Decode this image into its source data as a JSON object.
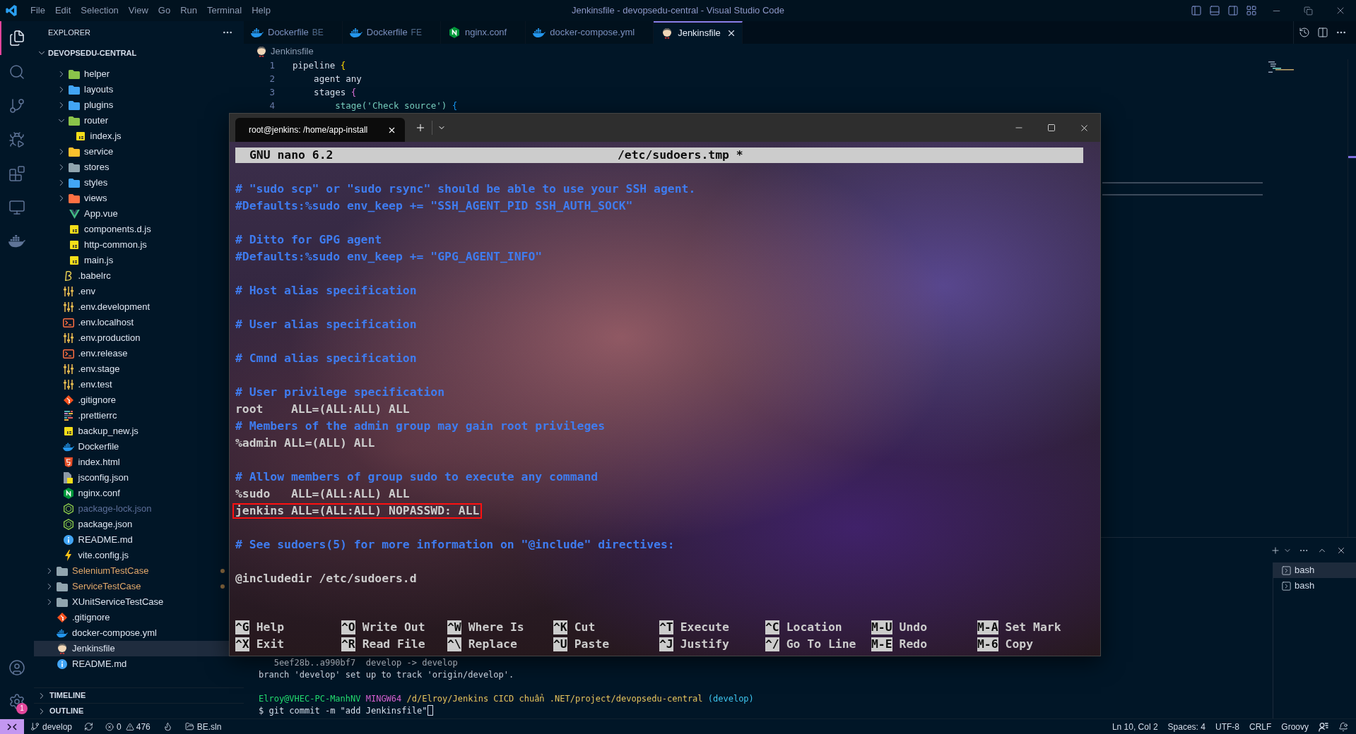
{
  "title_bar": {
    "menu": [
      "File",
      "Edit",
      "Selection",
      "View",
      "Go",
      "Run",
      "Terminal",
      "Help"
    ],
    "title": "Jenkinsfile - devopsedu-central - Visual Studio Code"
  },
  "activity_bar": {
    "items": [
      {
        "kind": "explorer",
        "selected": true
      },
      {
        "kind": "search",
        "selected": false
      },
      {
        "kind": "source-control",
        "selected": false
      },
      {
        "kind": "run-debug",
        "selected": false
      },
      {
        "kind": "extensions",
        "selected": false
      },
      {
        "kind": "remote",
        "selected": false
      },
      {
        "kind": "docker",
        "selected": false
      }
    ],
    "bottom": [
      {
        "kind": "account"
      },
      {
        "kind": "manage",
        "badge": "1"
      }
    ]
  },
  "sidebar": {
    "title": "EXPLORER",
    "folder": "DEVOPSEDU-CENTRAL",
    "tree": [
      {
        "children": [
          {
            "children": [
              {
                "label": "helper",
                "kind": "folder",
                "color": "#8bc34a",
                "expanded": false,
                "selected": false
              },
              {
                "label": "layouts",
                "kind": "folder",
                "color": "#42a5f5",
                "expanded": false,
                "selected": false
              },
              {
                "label": "plugins",
                "kind": "folder",
                "color": "#42a5f5",
                "expanded": false,
                "selected": false
              },
              {
                "label": "router",
                "kind": "folder",
                "color": "#8bc34a",
                "expanded": true,
                "selected": false,
                "children": [
                  {
                    "label": "index.js",
                    "kind": "js",
                    "selected": false
                  }
                ]
              },
              {
                "label": "service",
                "kind": "folder",
                "color": "#fbc02d",
                "expanded": false,
                "selected": false
              },
              {
                "label": "stores",
                "kind": "folder",
                "color": "#90a4ae",
                "expanded": false,
                "selected": false
              },
              {
                "label": "styles",
                "kind": "folder",
                "color": "#42a5f5",
                "expanded": false,
                "selected": false
              },
              {
                "label": "views",
                "kind": "folder",
                "color": "#ff7043",
                "expanded": false,
                "selected": false
              },
              {
                "label": "App.vue",
                "kind": "vue",
                "selected": false
              },
              {
                "label": "components.d.js",
                "kind": "js",
                "selected": false
              },
              {
                "label": "http-common.js",
                "kind": "js",
                "selected": false
              },
              {
                "label": "main.js",
                "kind": "js",
                "selected": false
              }
            ]
          },
          {
            "label": ".babelrc",
            "kind": "babel",
            "ignored": false,
            "selected": false
          },
          {
            "label": ".env",
            "kind": "env",
            "ignored": false,
            "selected": false
          },
          {
            "label": ".env.development",
            "kind": "env",
            "ignored": false,
            "selected": false
          },
          {
            "label": ".env.localhost",
            "kind": "shell",
            "ignored": false,
            "selected": false
          },
          {
            "label": ".env.production",
            "kind": "env",
            "ignored": false,
            "selected": false
          },
          {
            "label": ".env.release",
            "kind": "shell",
            "ignored": false,
            "selected": false
          },
          {
            "label": ".env.stage",
            "kind": "env",
            "ignored": false,
            "selected": false
          },
          {
            "label": ".env.test",
            "kind": "env",
            "ignored": false,
            "selected": false
          },
          {
            "label": ".gitignore",
            "kind": "git",
            "ignored": false,
            "selected": false
          },
          {
            "label": ".prettierrc",
            "kind": "prettier",
            "ignored": false,
            "selected": false
          },
          {
            "label": "backup_new.js",
            "kind": "js",
            "ignored": false,
            "selected": false
          },
          {
            "label": "Dockerfile",
            "kind": "docker",
            "ignored": false,
            "selected": false
          },
          {
            "label": "index.html",
            "kind": "html",
            "ignored": false,
            "selected": false
          },
          {
            "label": "jsconfig.json",
            "kind": "jsconfig",
            "ignored": false,
            "selected": false
          },
          {
            "label": "nginx.conf",
            "kind": "nginx",
            "ignored": false,
            "selected": false
          },
          {
            "label": "package-lock.json",
            "kind": "node",
            "ignored": true,
            "selected": false
          },
          {
            "label": "package.json",
            "kind": "node",
            "ignored": false,
            "selected": false
          },
          {
            "label": "README.md",
            "kind": "info",
            "ignored": false,
            "selected": false
          },
          {
            "label": "vite.config.js",
            "kind": "vite",
            "ignored": false,
            "selected": false
          }
        ]
      },
      {
        "label": "SeleniumTestCase",
        "kind": "folder",
        "color": "#90a4ae",
        "expanded": false,
        "modified": true,
        "selected": false
      },
      {
        "label": "ServiceTestCase",
        "kind": "folder",
        "color": "#90a4ae",
        "expanded": false,
        "modified": true,
        "selected": false
      },
      {
        "label": "XUnitServiceTestCase",
        "kind": "folder",
        "color": "#90a4ae",
        "expanded": false,
        "modified": false,
        "selected": false
      },
      {
        "label": ".gitignore",
        "kind": "git",
        "modified": false,
        "selected": false
      },
      {
        "label": "docker-compose.yml",
        "kind": "docker",
        "modified": false,
        "selected": false
      },
      {
        "label": "Jenkinsfile",
        "kind": "jenkins",
        "modified": false,
        "selected": true
      },
      {
        "label": "README.md",
        "kind": "info",
        "modified": false,
        "selected": false
      }
    ],
    "sections": [
      {
        "label": "TIMELINE",
        "expanded": false
      },
      {
        "label": "OUTLINE",
        "expanded": false
      }
    ]
  },
  "tabs": [
    {
      "label": "Dockerfile",
      "description": "BE",
      "kind": "docker",
      "selected": false
    },
    {
      "label": "Dockerfile",
      "description": "FE",
      "kind": "docker",
      "selected": false
    },
    {
      "label": "nginx.conf",
      "kind": "nginx",
      "selected": false
    },
    {
      "label": "docker-compose.yml",
      "kind": "docker",
      "selected": false
    },
    {
      "label": "Jenkinsfile",
      "kind": "jenkins",
      "selected": true
    }
  ],
  "breadcrumb": {
    "label": "Jenkinsfile",
    "kind": "jenkins"
  },
  "editor": {
    "lines": [
      {
        "number": "1",
        "tokens": [
          {
            "text": "pipeline ",
            "kind": "plain"
          },
          {
            "text": "{",
            "kind": "bracket1"
          }
        ]
      },
      {
        "number": "2",
        "tokens": [
          {
            "text": "    agent any",
            "kind": "plain"
          }
        ]
      },
      {
        "number": "3",
        "tokens": [
          {
            "text": "    stages ",
            "kind": "plain"
          },
          {
            "text": "{",
            "kind": "bracket2"
          }
        ]
      },
      {
        "number": "4",
        "tokens": [
          {
            "text": "        stage('Check source') ",
            "kind": "call"
          },
          {
            "text": "{",
            "kind": "bracket3"
          }
        ]
      }
    ]
  },
  "terminal_window": {
    "tab": "root@jenkins: /home/app-install",
    "nano": {
      "version": "GNU nano 6.2",
      "file": "/etc/sudoers.tmp *",
      "lines": [
        {
          "kind": "comment",
          "text": "# \"sudo scp\" or \"sudo rsync\" should be able to use your SSH agent.",
          "highlighted": false
        },
        {
          "kind": "comment",
          "text": "#Defaults:%sudo env_keep += \"SSH_AGENT_PID SSH_AUTH_SOCK\"",
          "highlighted": false
        },
        {
          "kind": "blank"
        },
        {
          "kind": "comment",
          "text": "# Ditto for GPG agent",
          "highlighted": false
        },
        {
          "kind": "comment",
          "text": "#Defaults:%sudo env_keep += \"GPG_AGENT_INFO\"",
          "highlighted": false
        },
        {
          "kind": "blank"
        },
        {
          "kind": "comment",
          "text": "# Host alias specification",
          "highlighted": false
        },
        {
          "kind": "blank"
        },
        {
          "kind": "comment",
          "text": "# User alias specification",
          "highlighted": false
        },
        {
          "kind": "blank"
        },
        {
          "kind": "comment",
          "text": "# Cmnd alias specification",
          "highlighted": false
        },
        {
          "kind": "blank"
        },
        {
          "kind": "comment",
          "text": "# User privilege specification",
          "highlighted": false
        },
        {
          "kind": "rule",
          "text": "root    ALL=(ALL:ALL) ALL",
          "highlighted": false
        },
        {
          "kind": "comment",
          "text": "# Members of the admin group may gain root privileges",
          "highlighted": false
        },
        {
          "kind": "rule",
          "text": "%admin ALL=(ALL) ALL",
          "highlighted": false
        },
        {
          "kind": "blank"
        },
        {
          "kind": "comment",
          "text": "# Allow members of group sudo to execute any command",
          "highlighted": false
        },
        {
          "kind": "rule",
          "text": "%sudo   ALL=(ALL:ALL) ALL",
          "highlighted": false
        },
        {
          "kind": "rule",
          "text": "jenkins ALL=(ALL:ALL) NOPASSWD: ALL",
          "highlighted": true
        },
        {
          "kind": "blank"
        },
        {
          "kind": "comment",
          "text": "# See sudoers(5) for more information on \"@include\" directives:",
          "highlighted": false
        },
        {
          "kind": "blank"
        },
        {
          "kind": "rule",
          "text": "@includedir /etc/sudoers.d",
          "highlighted": false
        }
      ],
      "shortcuts": [
        [
          {
            "key": "^G",
            "label": "Help"
          },
          {
            "key": "^O",
            "label": "Write Out"
          },
          {
            "key": "^W",
            "label": "Where Is"
          },
          {
            "key": "^K",
            "label": "Cut"
          },
          {
            "key": "^T",
            "label": "Execute"
          },
          {
            "key": "^C",
            "label": "Location"
          },
          {
            "key": "M-U",
            "label": "Undo"
          },
          {
            "key": "M-A",
            "label": "Set Mark"
          }
        ],
        [
          {
            "key": "^X",
            "label": "Exit"
          },
          {
            "key": "^R",
            "label": "Read File"
          },
          {
            "key": "^\\",
            "label": "Replace"
          },
          {
            "key": "^U",
            "label": "Paste"
          },
          {
            "key": "^J",
            "label": "Justify"
          },
          {
            "key": "^/",
            "label": "Go To Line"
          },
          {
            "key": "M-E",
            "label": "Redo"
          },
          {
            "key": "M-6",
            "label": "Copy"
          }
        ]
      ]
    }
  },
  "panel": {
    "lines": [
      {
        "kind": "output",
        "segments": [
          {
            "text": "   5eef28b..a990bf7  develop -> develop",
            "kind": "plain"
          }
        ],
        "cursor": false
      },
      {
        "kind": "output",
        "segments": [
          {
            "text": "branch 'develop' set up to track 'origin/develop'.",
            "kind": "plain"
          }
        ],
        "cursor": false
      },
      {
        "kind": "blank"
      },
      {
        "kind": "output",
        "segments": [
          {
            "text": "Elroy@VHEC-PC-ManhNV",
            "kind": "user"
          },
          {
            "text": " MINGW64",
            "kind": "system"
          },
          {
            "text": " /d/Elroy/Jenkins CICD chuẩn .NET/project/devopsedu-central",
            "kind": "path"
          },
          {
            "text": " (develop)",
            "kind": "branch"
          }
        ],
        "cursor": false
      },
      {
        "kind": "output",
        "segments": [
          {
            "text": "$ git commit -m \"add Jenkinsfile\"",
            "kind": "plain"
          }
        ],
        "cursor": true
      }
    ],
    "terminals": [
      {
        "label": "bash",
        "selected": true
      },
      {
        "label": "bash",
        "selected": false
      }
    ]
  },
  "status_bar": {
    "branch": "develop",
    "errors": "0",
    "warnings": "476",
    "solution": "BE.sln",
    "items": [
      "Ln 10, Col 2",
      "Spaces: 4",
      "UTF-8",
      "CRLF",
      "Groovy"
    ]
  }
}
